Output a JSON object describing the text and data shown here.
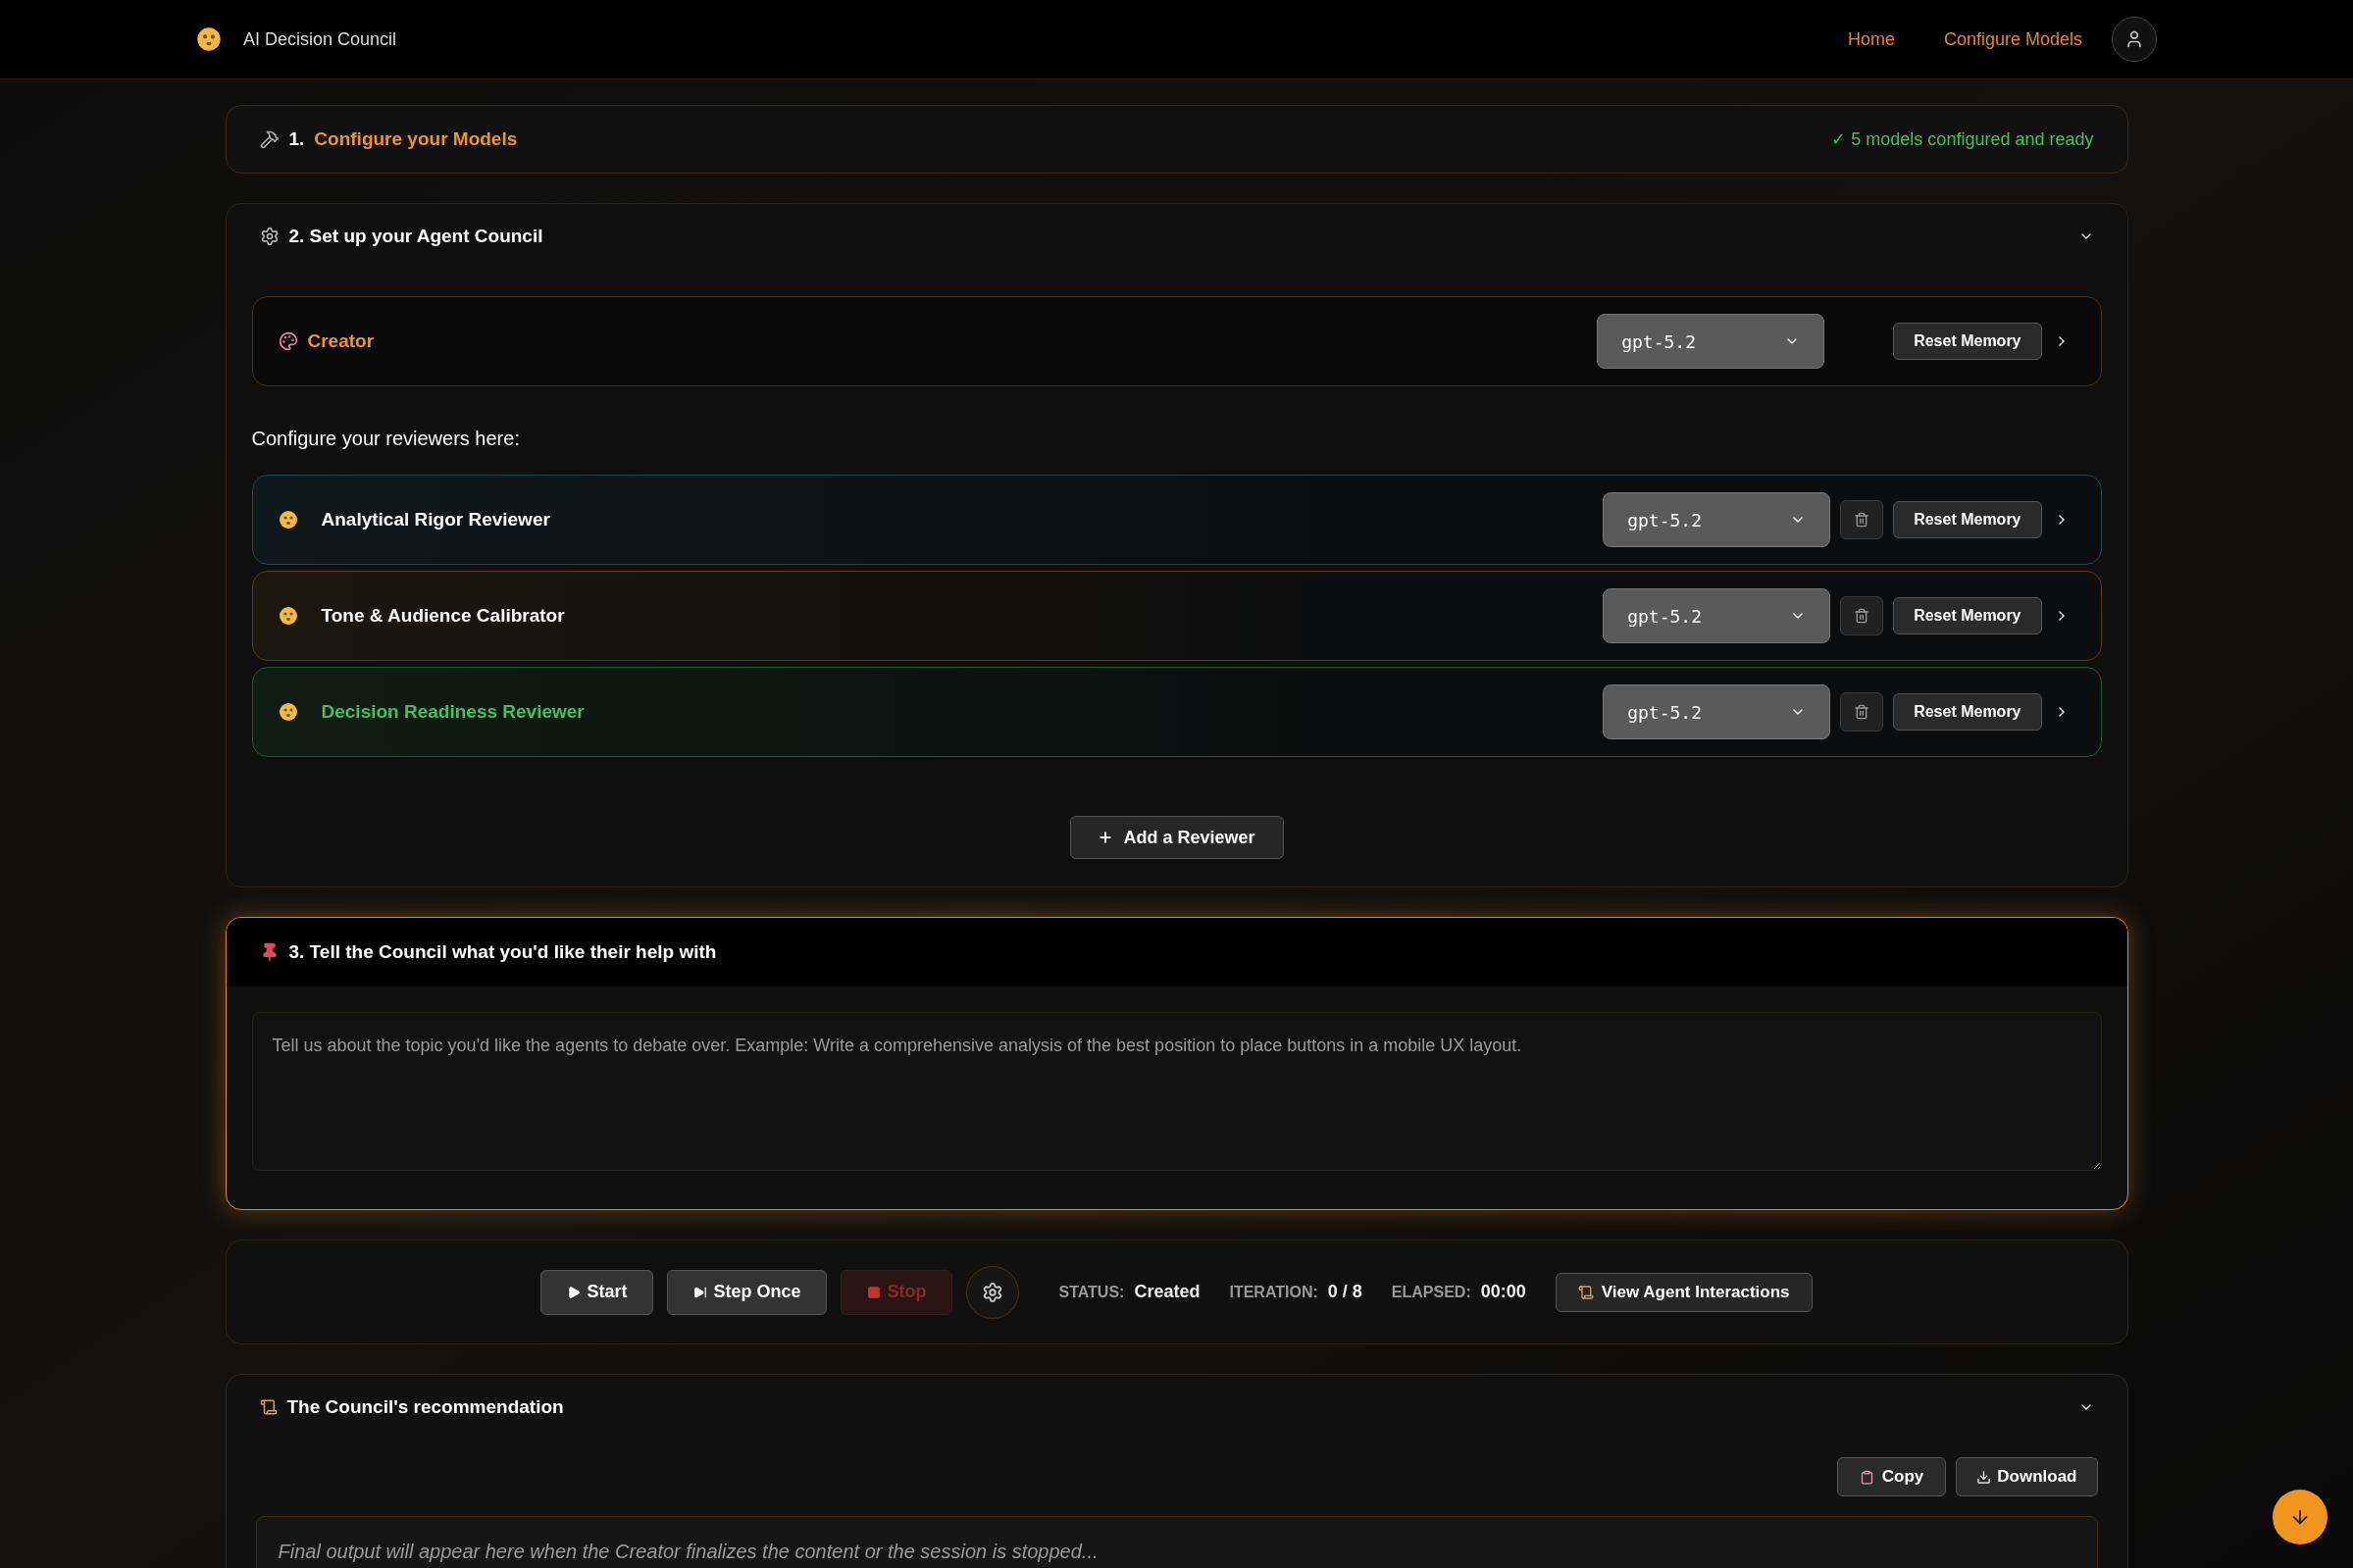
{
  "header": {
    "title": "AI Decision Council",
    "nav": [
      {
        "label": "Home"
      },
      {
        "label": "Configure Models"
      }
    ]
  },
  "step1": {
    "number": "1.",
    "title": "Configure your Models",
    "status": "✓ 5 models configured and ready"
  },
  "step2": {
    "title": "2. Set up your Agent Council",
    "expanded": true,
    "creator": {
      "name": "Creator",
      "model": "gpt-5.2",
      "reset": "Reset Memory"
    },
    "reviewers_label": "Configure your reviewers here:",
    "reviewers": [
      {
        "name": "Analytical Rigor Reviewer",
        "model": "gpt-5.2",
        "reset": "Reset Memory",
        "color": "#1f4656",
        "highlighted": false
      },
      {
        "name": "Tone & Audience Calibrator",
        "model": "gpt-5.2",
        "reset": "Reset Memory",
        "color": "#5c3c12",
        "highlighted": false
      },
      {
        "name": "Decision Readiness Reviewer",
        "model": "gpt-5.2",
        "reset": "Reset Memory",
        "color": "#1d5a2f",
        "highlighted": true
      }
    ],
    "add_button": "Add a Reviewer"
  },
  "step3": {
    "title": "3. Tell the Council what you'd like their help with",
    "placeholder": "Tell us about the topic you'd like the agents to debate over. Example: Write a comprehensive analysis of the best position to place buttons in a mobile UX layout."
  },
  "controls": {
    "buttons": [
      {
        "kind": "start",
        "label": "Start",
        "disabled": false
      },
      {
        "kind": "step",
        "label": "Step Once",
        "disabled": false
      },
      {
        "kind": "stop",
        "label": "Stop",
        "disabled": true
      }
    ],
    "stats": [
      {
        "label": "STATUS:",
        "value": "Created"
      },
      {
        "label": "ITERATION:",
        "value": "0 / 8"
      },
      {
        "label": "ELAPSED:",
        "value": "00:00"
      }
    ],
    "view_button": "View Agent Interactions"
  },
  "recommendation": {
    "title": "The Council's recommendation",
    "expanded": true,
    "copy": "Copy",
    "download": "Download",
    "placeholder": "Final output will appear here when the Creator finalizes the content or the session is stopped..."
  }
}
